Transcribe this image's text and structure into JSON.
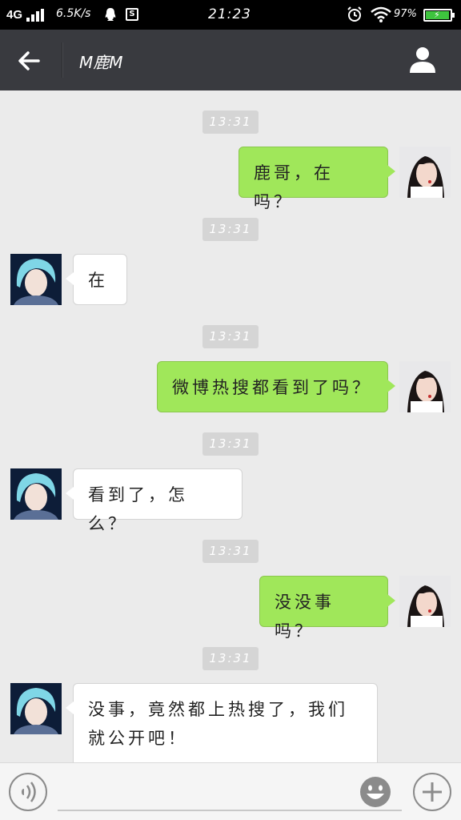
{
  "status_bar": {
    "network": "4G",
    "speed": "6.5K/s",
    "s_badge": "S",
    "time": "21:23",
    "battery_percent": "97%",
    "battery_level": 0.97
  },
  "header": {
    "title": "M鹿M",
    "back_icon": "arrow-left-icon",
    "profile_icon": "person-icon"
  },
  "messages": [
    {
      "type": "timestamp",
      "text": "13:31"
    },
    {
      "type": "out",
      "text": "鹿哥，在吗？"
    },
    {
      "type": "timestamp",
      "text": "13:31"
    },
    {
      "type": "in",
      "text": "在"
    },
    {
      "type": "timestamp",
      "text": "13:31"
    },
    {
      "type": "out",
      "text": "微博热搜都看到了吗？"
    },
    {
      "type": "timestamp",
      "text": "13:31"
    },
    {
      "type": "in",
      "text": "看到了，怎么？"
    },
    {
      "type": "timestamp",
      "text": "13:31"
    },
    {
      "type": "out",
      "text": "没没事吗？"
    },
    {
      "type": "timestamp",
      "text": "13:31"
    },
    {
      "type": "in",
      "text": "没事，竟然都上热搜了，我们就公开吧！"
    }
  ],
  "input_bar": {
    "voice_icon": "voice-icon",
    "emoji_icon": "emoji-icon",
    "plus_icon": "plus-icon"
  },
  "colors": {
    "status_bg": "#000000",
    "header_bg": "#393a3f",
    "chat_bg": "#ebebeb",
    "out_bubble": "#a0e75a",
    "in_bubble": "#ffffff",
    "timestamp_bg": "#d5d5d5"
  }
}
